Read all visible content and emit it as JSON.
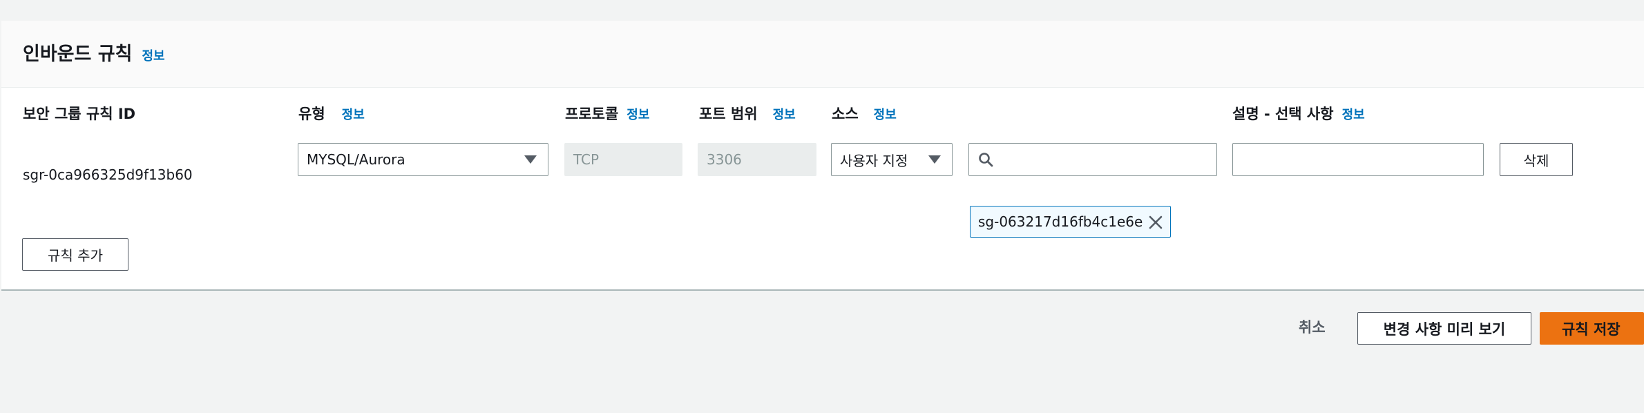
{
  "panel": {
    "title": "인바운드 규칙",
    "info": "정보"
  },
  "columns": {
    "rule_id": "보안 그룹 규칙 ID",
    "type": "유형",
    "protocol": "프로토콜",
    "port_range": "포트 범위",
    "source": "소스",
    "description": "설명 - 선택 사항",
    "info": "정보"
  },
  "rule": {
    "id": "sgr-0ca966325d9f13b60",
    "type": "MYSQL/Aurora",
    "protocol": "TCP",
    "port_range": "3306",
    "source_type": "사용자 지정",
    "source_search": "",
    "source_token": "sg-063217d16fb4c1e6e",
    "description": "",
    "delete_label": "삭제"
  },
  "add_rule_label": "규칙 추가",
  "footer": {
    "cancel": "취소",
    "preview": "변경 사항 미리 보기",
    "save": "규칙 저장"
  },
  "colors": {
    "accent": "#ec7211",
    "link": "#0073bb",
    "token_bg": "#f1faff"
  }
}
